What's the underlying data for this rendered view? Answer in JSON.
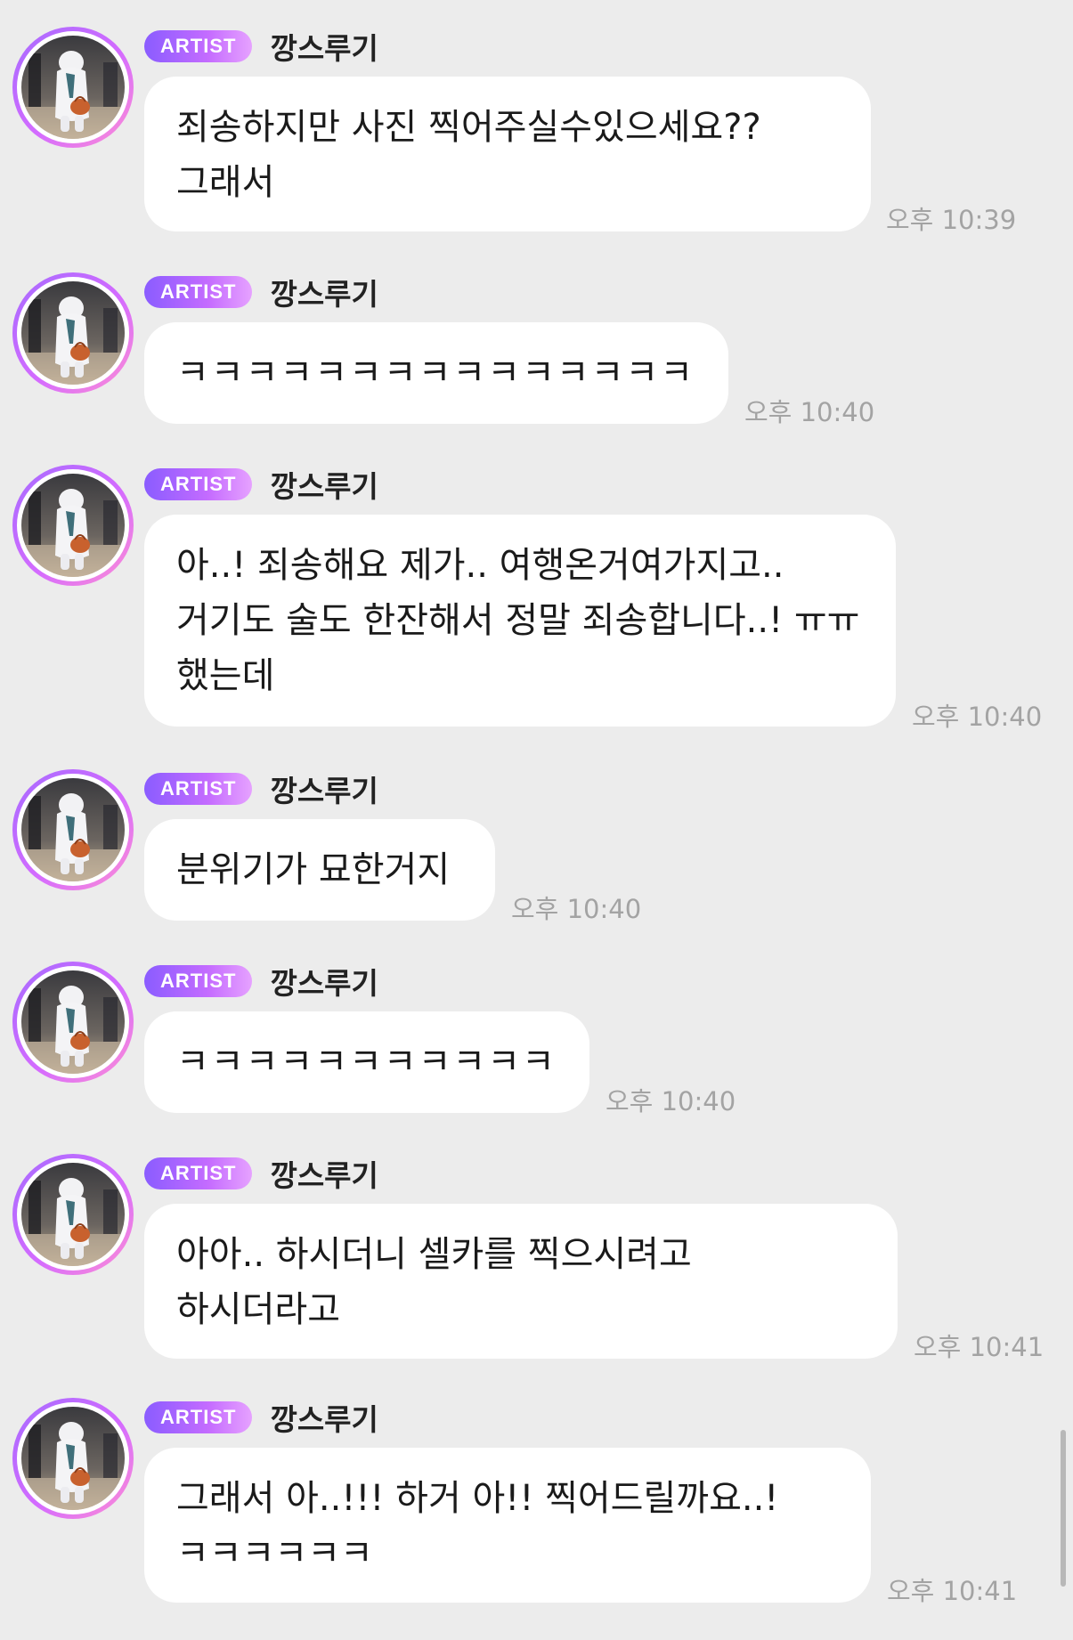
{
  "messages": [
    {
      "badge": "ARTIST",
      "sender": "깡스루기",
      "text": "죄송하지만 사진 찍어주실수있으세요?? 그래서",
      "time": "오후 10:39"
    },
    {
      "badge": "ARTIST",
      "sender": "깡스루기",
      "text": "ㅋㅋㅋㅋㅋㅋㅋㅋㅋㅋㅋㅋㅋㅋㅋ",
      "time": "오후 10:40"
    },
    {
      "badge": "ARTIST",
      "sender": "깡스루기",
      "text": "아..! 죄송해요 제가.. 여행온거여가지고.. 거기도 술도 한잔해서 정말 죄송합니다..! ㅠㅠ 했는데",
      "time": "오후 10:40"
    },
    {
      "badge": "ARTIST",
      "sender": "깡스루기",
      "text": "분위기가 묘한거지",
      "time": "오후 10:40"
    },
    {
      "badge": "ARTIST",
      "sender": "깡스루기",
      "text": "ㅋㅋㅋㅋㅋㅋㅋㅋㅋㅋㅋ",
      "time": "오후 10:40"
    },
    {
      "badge": "ARTIST",
      "sender": "깡스루기",
      "text": "아아.. 하시더니 셀카를 찍으시려고 하시더라고",
      "time": "오후 10:41"
    },
    {
      "badge": "ARTIST",
      "sender": "깡스루기",
      "text": "그래서 아..!!! 하거 아!! 찍어드릴까요..! ㅋㅋㅋㅋㅋㅋ",
      "time": "오후 10:41"
    }
  ],
  "avatar_icon": "profile-photo-icon"
}
